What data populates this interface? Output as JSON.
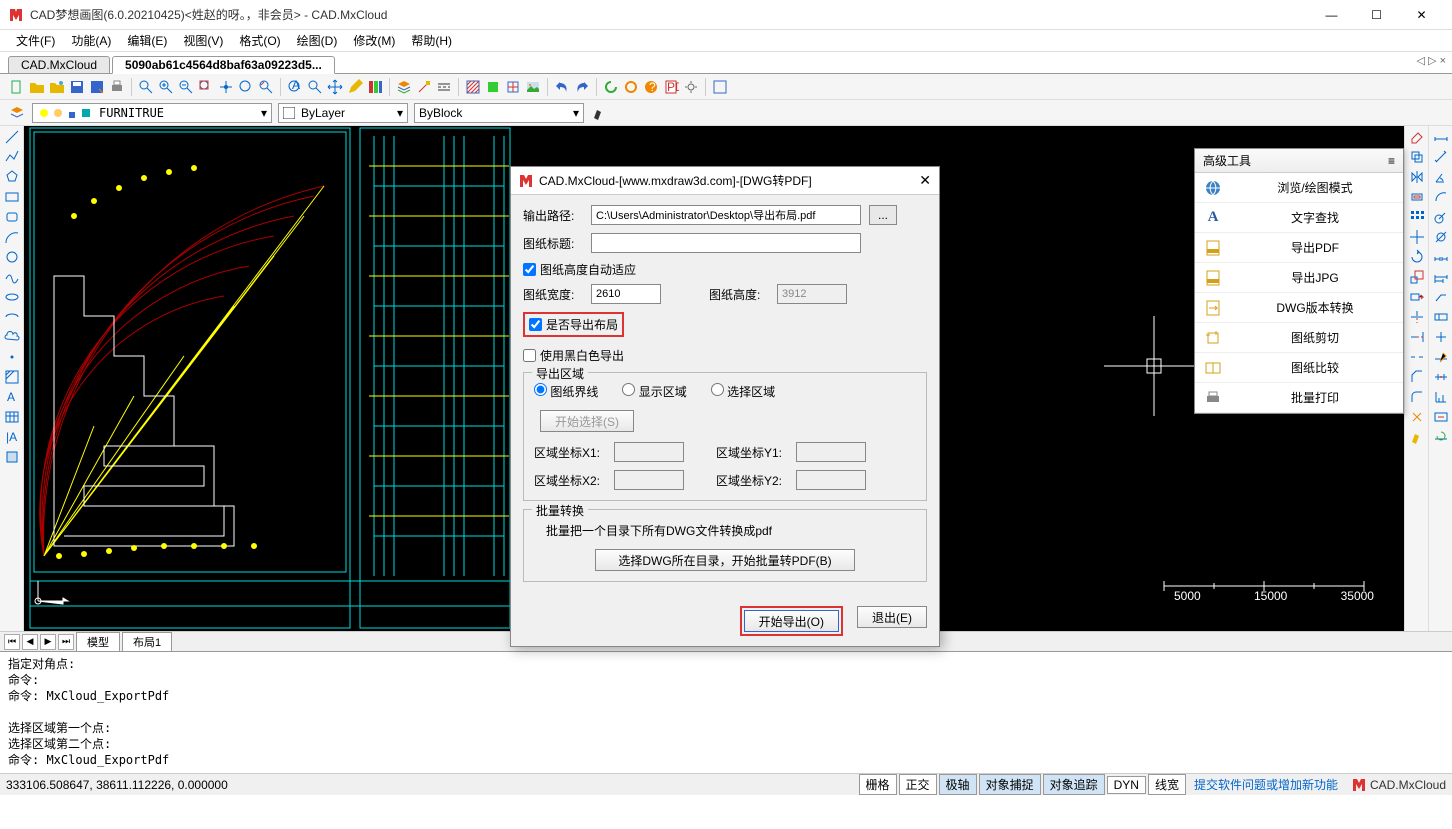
{
  "window": {
    "title": "CAD梦想画图(6.0.20210425)<姓赵的呀。，非会员> - CAD.MxCloud",
    "min": "—",
    "max": "☐",
    "close": "✕"
  },
  "menu": [
    "文件(F)",
    "功能(A)",
    "编辑(E)",
    "视图(V)",
    "格式(O)",
    "绘图(D)",
    "修改(M)",
    "帮助(H)"
  ],
  "doctabs": {
    "t1": "CAD.MxCloud",
    "t2": "5090ab61c4564d8baf63a09223d5...",
    "right": "◁ ▷ ×"
  },
  "layer": {
    "furniture_label": "FURNITRUE",
    "bylayer": "ByLayer",
    "byblock": "ByBlock"
  },
  "adv": {
    "title": "高级工具",
    "menu_icon": "≡",
    "items": [
      {
        "icon": "globe",
        "label": "浏览/绘图模式",
        "color": "#3b82c4"
      },
      {
        "icon": "A",
        "label": "文字查找",
        "color": "#2b5aa0"
      },
      {
        "icon": "pdf",
        "label": "导出PDF",
        "color": "#d4a019"
      },
      {
        "icon": "jpg",
        "label": "导出JPG",
        "color": "#d4a019"
      },
      {
        "icon": "dwg",
        "label": "DWG版本转换",
        "color": "#d4a019"
      },
      {
        "icon": "crop",
        "label": "图纸剪切",
        "color": "#d4a019"
      },
      {
        "icon": "cmp",
        "label": "图纸比较",
        "color": "#d4a019"
      },
      {
        "icon": "print",
        "label": "批量打印",
        "color": "#888"
      }
    ]
  },
  "dialog": {
    "title": "CAD.MxCloud-[www.mxdraw3d.com]-[DWG转PDF]",
    "close": "✕",
    "out_path_lbl": "输出路径:",
    "out_path_val": "C:\\Users\\Administrator\\Desktop\\导出布局.pdf",
    "browse": "...",
    "sheet_title_lbl": "图纸标题:",
    "sheet_title_val": "",
    "auto_height": "图纸高度自动适应",
    "width_lbl": "图纸宽度:",
    "width_val": "2610",
    "height_lbl": "图纸高度:",
    "height_val": "3912",
    "export_layout": "是否导出布局",
    "bw_export": "使用黑白色导出",
    "area_grp": "导出区域",
    "r1": "图纸界线",
    "r2": "显示区域",
    "r3": "选择区域",
    "start_select": "开始选择(S)",
    "x1_lbl": "区域坐标X1:",
    "y1_lbl": "区域坐标Y1:",
    "x2_lbl": "区域坐标X2:",
    "y2_lbl": "区域坐标Y2:",
    "batch_grp": "批量转换",
    "batch_desc": "批量把一个目录下所有DWG文件转换成pdf",
    "batch_btn": "选择DWG所在目录，开始批量转PDF(B)",
    "ok": "开始导出(O)",
    "cancel": "退出(E)"
  },
  "scalebar": {
    "l": "5000",
    "m": "15000",
    "r": "35000"
  },
  "sheettabs": {
    "model": "模型",
    "layout1": "布局1"
  },
  "cmd": "指定对角点:\n命令:\n命令: MxCloud_ExportPdf\n\n选择区域第一个点:\n选择区域第二个点:\n命令: MxCloud_ExportPdf",
  "status": {
    "coords": "333106.508647,  38611.112226,  0.000000",
    "btns": [
      "栅格",
      "正交",
      "极轴",
      "对象捕捉",
      "对象追踪",
      "DYN",
      "线宽"
    ],
    "link": "提交软件问题或增加新功能",
    "brand": "CAD.MxCloud"
  }
}
